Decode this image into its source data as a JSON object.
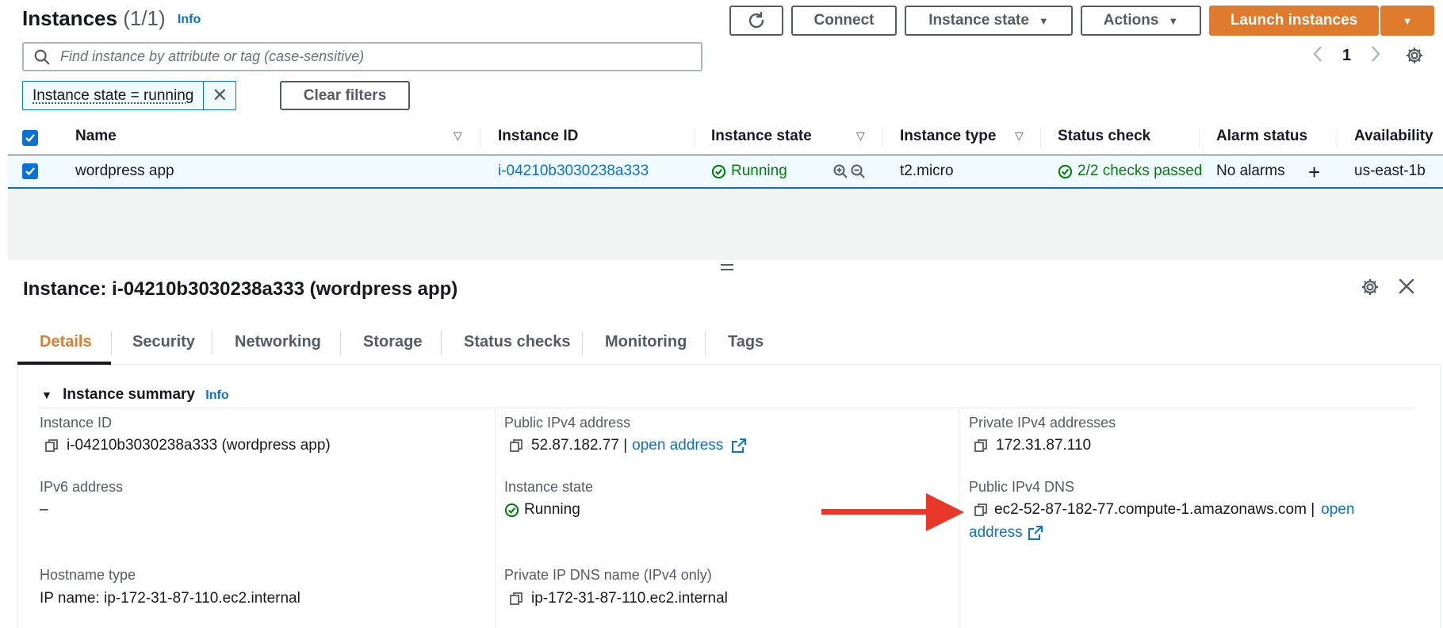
{
  "header": {
    "title": "Instances",
    "count": "(1/1)",
    "info": "Info",
    "buttons": {
      "connect": "Connect",
      "instance_state": "Instance state",
      "actions": "Actions",
      "launch": "Launch instances"
    }
  },
  "search": {
    "placeholder": "Find instance by attribute or tag (case-sensitive)"
  },
  "pagination": {
    "page": "1"
  },
  "filter": {
    "chip": "Instance state = running",
    "clear": "Clear filters"
  },
  "table": {
    "columns": [
      "Name",
      "Instance ID",
      "Instance state",
      "Instance type",
      "Status check",
      "Alarm status",
      "Availability"
    ],
    "row": {
      "name": "wordpress app",
      "instance_id": "i-04210b3030238a333",
      "state": "Running",
      "type": "t2.micro",
      "status_check": "2/2 checks passed",
      "alarm": "No alarms",
      "az": "us-east-1b"
    }
  },
  "details": {
    "title": "Instance: i-04210b3030238a333 (wordpress app)",
    "tabs": [
      "Details",
      "Security",
      "Networking",
      "Storage",
      "Status checks",
      "Monitoring",
      "Tags"
    ],
    "summary_title": "Instance summary",
    "summary_info": "Info",
    "fields": {
      "instance_id": {
        "label": "Instance ID",
        "value": "i-04210b3030238a333 (wordpress app)"
      },
      "public_ipv4": {
        "label": "Public IPv4 address",
        "value": "52.87.182.77 |",
        "link": "open address"
      },
      "private_ipv4": {
        "label": "Private IPv4 addresses",
        "value": "172.31.87.110"
      },
      "ipv6": {
        "label": "IPv6 address",
        "value": "–"
      },
      "instance_state": {
        "label": "Instance state",
        "value": "Running"
      },
      "public_dns": {
        "label": "Public IPv4 DNS",
        "value": "ec2-52-87-182-77.compute-1.amazonaws.com |",
        "link1": "open",
        "link2": "address"
      },
      "hostname_type": {
        "label": "Hostname type",
        "value": "IP name: ip-172-31-87-110.ec2.internal"
      },
      "private_dns": {
        "label": "Private IP DNS name (IPv4 only)",
        "value": "ip-172-31-87-110.ec2.internal"
      }
    }
  },
  "colors": {
    "primary": "#e07a2c",
    "link": "#0972d3",
    "success": "#037f0c",
    "annotation_arrow": "#e8382a"
  }
}
